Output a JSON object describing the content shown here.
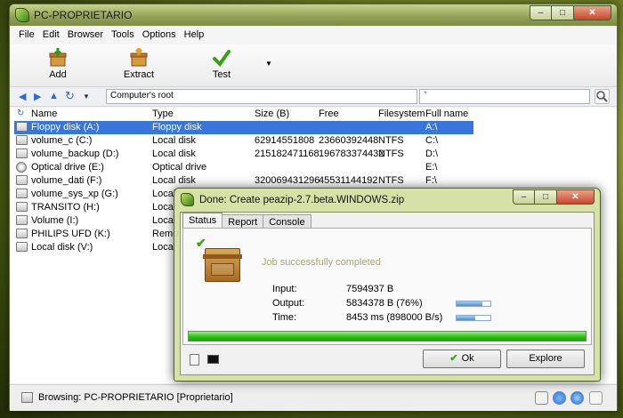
{
  "window": {
    "title": "PC-PROPRIETARIO",
    "minimize_glyph": "–",
    "maximize_glyph": "□",
    "close_glyph": "✕"
  },
  "menu": [
    "File",
    "Edit",
    "Browser",
    "Tools",
    "Options",
    "Help"
  ],
  "toolbar": {
    "add_label": "Add",
    "extract_label": "Extract",
    "test_label": "Test",
    "dropdown_glyph": "▼"
  },
  "address": {
    "value": "Computer's root",
    "filter_value": "*"
  },
  "columns": [
    "Name",
    "Type",
    "Size (B)",
    "Free",
    "Filesystem",
    "Full name"
  ],
  "rows": [
    {
      "name": "Floppy disk (A:)",
      "type": "Floppy disk",
      "size": "",
      "free": "",
      "fs": "",
      "full": "A:\\"
    },
    {
      "name": "volume_c (C:)",
      "type": "Local disk",
      "size": "62914551808",
      "free": "23660392448",
      "fs": "NTFS",
      "full": "C:\\"
    },
    {
      "name": "volume_backup (D:)",
      "type": "Local disk",
      "size": "215182471168",
      "free": "196783374432",
      "fs": "NTFS",
      "full": "D:\\"
    },
    {
      "name": "Optical drive (E:)",
      "type": "Optical drive",
      "size": "",
      "free": "",
      "fs": "",
      "full": "E:\\"
    },
    {
      "name": "volume_dati (F:)",
      "type": "Local disk",
      "size": "320069431296",
      "free": "45531144192",
      "fs": "NTFS",
      "full": "F:\\"
    },
    {
      "name": "volume_sys_xp (G:)",
      "type": "Local",
      "size": "",
      "free": "",
      "fs": "",
      "full": ""
    },
    {
      "name": "TRANSITO (H:)",
      "type": "Local",
      "size": "",
      "free": "",
      "fs": "",
      "full": ""
    },
    {
      "name": "Volume (I:)",
      "type": "Local",
      "size": "",
      "free": "",
      "fs": "",
      "full": ""
    },
    {
      "name": "PHILIPS UFD (K:)",
      "type": "Remo",
      "size": "",
      "free": "",
      "fs": "",
      "full": ""
    },
    {
      "name": "Local disk (V:)",
      "type": "Local",
      "size": "",
      "free": "",
      "fs": "",
      "full": ""
    }
  ],
  "status": {
    "text": "Browsing: PC-PROPRIETARIO [Proprietario]"
  },
  "dialog": {
    "title": "Done: Create peazip-2.7.beta.WINDOWS.zip",
    "tabs": [
      "Status",
      "Report",
      "Console"
    ],
    "job_message": "Job successfully completed",
    "input_label": "Input:",
    "input_value": "7594937 B",
    "output_label": "Output:",
    "output_value": "5834378 B (76%)",
    "output_ratio": 0.76,
    "time_label": "Time:",
    "time_value": "8453 ms (898000 B/s)",
    "time_ratio": 0.55,
    "progress": 1.0,
    "ok_label": "Ok",
    "explore_label": "Explore"
  },
  "colors": {
    "selection": "#3a76d8",
    "progress_green": "#2ec018",
    "titlebar": "#96a45a"
  }
}
